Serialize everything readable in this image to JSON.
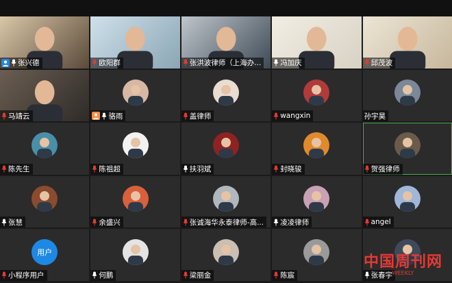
{
  "participants": [
    {
      "name": "张兴德",
      "avatar": "video-man-glasses",
      "host": true
    },
    {
      "name": "欧阳群",
      "avatar": "video-man-window"
    },
    {
      "name": "张洪波律师（上海办...",
      "avatar": "video-man-suit"
    },
    {
      "name": "冯加庆",
      "avatar": "video-man-home"
    },
    {
      "name": "邱茂波",
      "avatar": "video-man-red-decor"
    },
    {
      "name": "马靖云",
      "avatar": "video-woman"
    },
    {
      "name": "骆雨",
      "avatar": "photo-woman",
      "host": true
    },
    {
      "name": "盖律师",
      "avatar": "photo-woman-2"
    },
    {
      "name": "wangxin",
      "avatar": "photo-hand"
    },
    {
      "name": "孙宇昊",
      "avatar": "photo-man-room",
      "nomic": true
    },
    {
      "name": "陈先生",
      "avatar": "photo-island"
    },
    {
      "name": "陈祖超",
      "avatar": "photo-drawing"
    },
    {
      "name": "扶羽斌",
      "avatar": "photo-man-red"
    },
    {
      "name": "封晓骏",
      "avatar": "photo-sunset"
    },
    {
      "name": "贺强律师",
      "avatar": "photo-man-office",
      "active": true
    },
    {
      "name": "张慧",
      "avatar": "photo-bookshelf"
    },
    {
      "name": "余盛兴",
      "avatar": "photo-man-color"
    },
    {
      "name": "张诚海华永泰律师-高...",
      "avatar": "photo-man-suit"
    },
    {
      "name": "凌凌律师",
      "avatar": "photo-flower"
    },
    {
      "name": "angel",
      "avatar": "photo-blue"
    },
    {
      "name": "小程序用户",
      "avatar": "text",
      "avatar_text": "用户"
    },
    {
      "name": "何鹏",
      "avatar": "photo-man-glasses"
    },
    {
      "name": "梁丽金",
      "avatar": "photo-woman-3"
    },
    {
      "name": "陈宸",
      "avatar": "photo-door"
    },
    {
      "name": "张春宇",
      "avatar": "photo-man-suit-2"
    }
  ],
  "watermark": {
    "cn": "中国周刊网",
    "en": "WEEKLY"
  },
  "colors": {
    "tile_bg": "#2b2b2b",
    "nameplate": "#000000",
    "mic_red": "#e53935",
    "active_border": "#4caf50"
  }
}
